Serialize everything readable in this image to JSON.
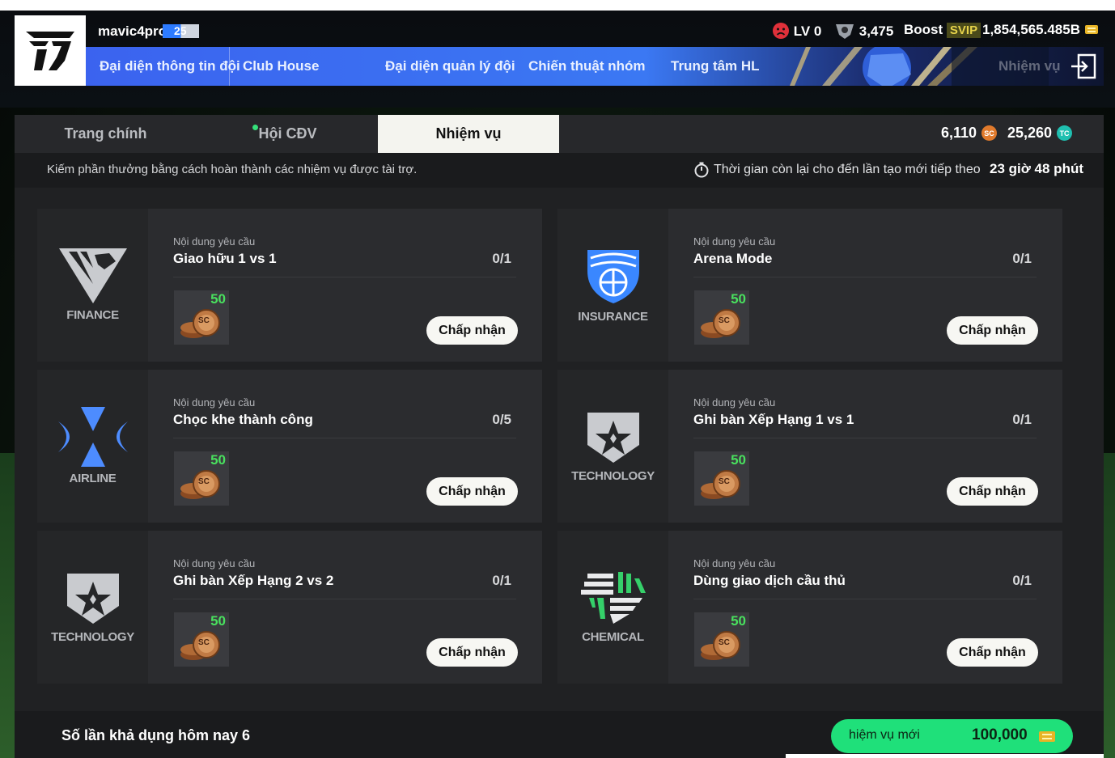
{
  "header": {
    "username": "mavic4pro",
    "user_level": "25",
    "nav": [
      {
        "label": "Đại diện thông tin đội"
      },
      {
        "label": "Club House"
      },
      {
        "label": "Đại diện quản lý đội"
      },
      {
        "label": "Chiến thuật nhóm"
      },
      {
        "label": "Trung tâm HL"
      }
    ],
    "nav_faded": "Nhiệm vụ",
    "lv": "LV 0",
    "points": "3,475",
    "boost": "Boost",
    "svip": "SVIP",
    "balance": "1,854,565.485B"
  },
  "tabs": [
    {
      "label": "Trang chính",
      "active": false
    },
    {
      "label": "Hội CĐV",
      "active": false
    },
    {
      "label": "Nhiệm vụ",
      "active": true
    }
  ],
  "currencies": {
    "sc": "6,110",
    "sc_icon": "SC",
    "tc": "25,260",
    "tc_icon": "TC"
  },
  "info": {
    "description": "Kiếm phần thưởng bằng cách hoàn thành các nhiệm vụ được tài trợ.",
    "timer_label": "Thời gian còn lại cho đến lần tạo mới tiếp theo",
    "timer_value": "23 giờ 48 phút"
  },
  "missions": [
    {
      "sponsor": "FINANCE",
      "req_label": "Nội dung yêu cầu",
      "title": "Giao hữu 1 vs 1",
      "progress": "0/1",
      "reward": "50",
      "reward_icon": "SC",
      "button": "Chấp nhận"
    },
    {
      "sponsor": "INSURANCE",
      "req_label": "Nội dung yêu cầu",
      "title": "Arena Mode",
      "progress": "0/1",
      "reward": "50",
      "reward_icon": "SC",
      "button": "Chấp nhận"
    },
    {
      "sponsor": "AIRLINE",
      "req_label": "Nội dung yêu cầu",
      "title": "Chọc khe thành công",
      "progress": "0/5",
      "reward": "50",
      "reward_icon": "SC",
      "button": "Chấp nhận"
    },
    {
      "sponsor": "TECHNOLOGY",
      "req_label": "Nội dung yêu cầu",
      "title": "Ghi bàn Xếp Hạng 1 vs 1",
      "progress": "0/1",
      "reward": "50",
      "reward_icon": "SC",
      "button": "Chấp nhận"
    },
    {
      "sponsor": "TECHNOLOGY",
      "req_label": "Nội dung yêu cầu",
      "title": "Ghi bàn Xếp Hạng 2 vs 2",
      "progress": "0/1",
      "reward": "50",
      "reward_icon": "SC",
      "button": "Chấp nhận"
    },
    {
      "sponsor": "CHEMICAL",
      "req_label": "Nội dung yêu cầu",
      "title": "Dùng giao dịch cầu thủ",
      "progress": "0/1",
      "reward": "50",
      "reward_icon": "SC",
      "button": "Chấp nhận"
    }
  ],
  "bottom": {
    "available_text": "Số lần khả dụng hôm nay 6",
    "new_mission_label": "hiệm vụ mới",
    "new_mission_price": "100,000"
  },
  "colors": {
    "nav_blue": "#3b63ef",
    "accept_green": "#1fe07a",
    "reward_green": "#49e05e",
    "panel_bg": "#202123"
  }
}
